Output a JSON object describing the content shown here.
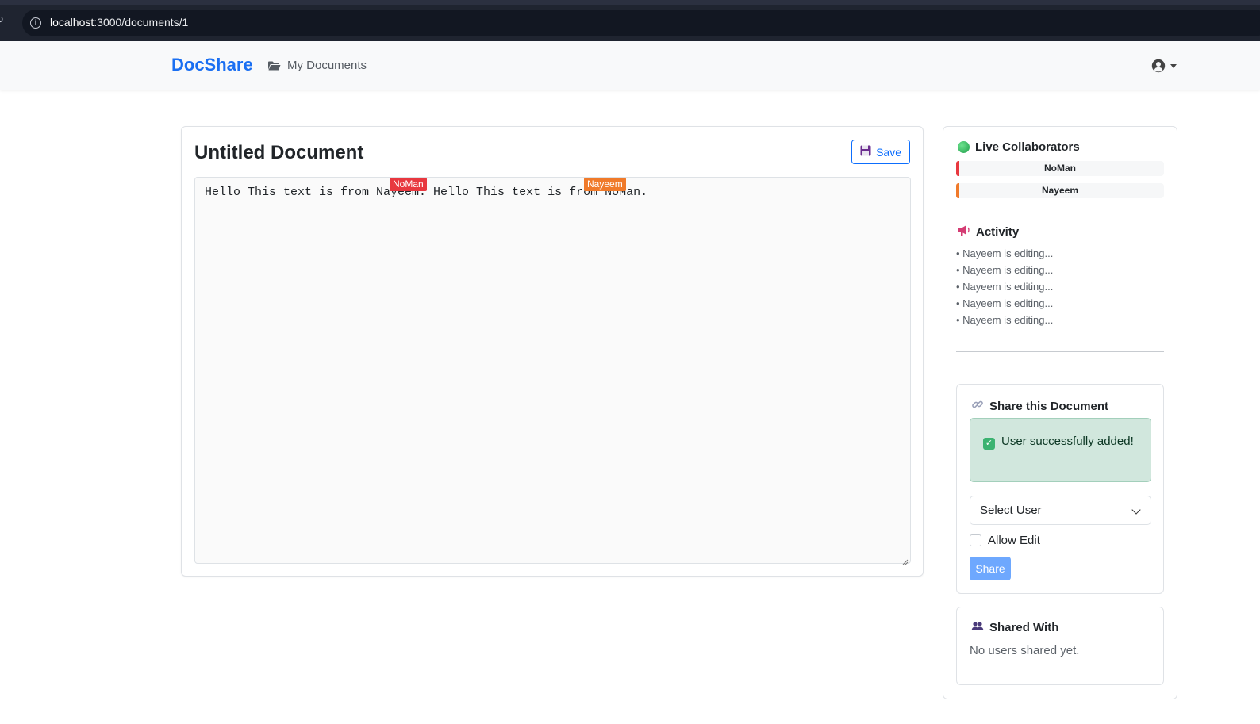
{
  "browser": {
    "url_host": "localhost",
    "url_rest": ":3000/documents/1"
  },
  "navbar": {
    "brand": "DocShare",
    "my_documents": "My Documents"
  },
  "document": {
    "title": "Untitled Document",
    "save_label": "Save",
    "content": "Hello This text is from Nayeem. Hello This text is from NoMan.",
    "cursors": [
      {
        "name": "NoMan",
        "color": "#e8383f"
      },
      {
        "name": "Nayeem",
        "color": "#f07a2a"
      }
    ]
  },
  "sidebar": {
    "collaborators_title": "Live Collaborators",
    "collaborators": [
      {
        "name": "NoMan",
        "color": "#e8383f"
      },
      {
        "name": "Nayeem",
        "color": "#f07a2a"
      }
    ],
    "activity_title": "Activity",
    "activity": [
      "• Nayeem is editing...",
      "• Nayeem is editing...",
      "• Nayeem is editing...",
      "• Nayeem is editing...",
      "• Nayeem is editing..."
    ],
    "share": {
      "title": "Share this Document",
      "alert": "User successfully added!",
      "select_placeholder": "Select User",
      "allow_edit_label": "Allow Edit",
      "share_button": "Share"
    },
    "shared_with": {
      "title": "Shared With",
      "empty": "No users shared yet."
    }
  },
  "icons": {
    "reload": "reload-icon",
    "info": "info-icon",
    "folder": "folder-icon",
    "user": "user-circle-icon",
    "save": "floppy-disk-icon",
    "live": "green-dot-icon",
    "activity": "megaphone-icon",
    "link": "link-icon",
    "check": "check-mark-icon",
    "users": "users-icon"
  }
}
